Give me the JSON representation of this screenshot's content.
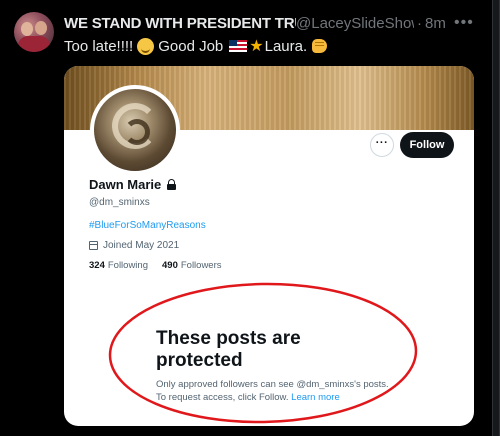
{
  "tweet": {
    "author_name": "WE STAND WITH PRESIDENT TRUMP",
    "handle": "@LaceySlideShow",
    "separator": "·",
    "time": "8m",
    "more_icon": "more-horizontal-icon",
    "text_part1": "Too late!!!!",
    "text_part2": "Good Job",
    "text_part3": "Laura.",
    "emojis": [
      "smiling-face-icon",
      "us-flag-icon",
      "star-icon",
      "oncoming-fist-icon"
    ]
  },
  "card": {
    "profile_name": "Dawn Marie",
    "profile_handle": "@dm_sminxs",
    "bio": "#BlueForSoManyReasons",
    "joined": "Joined May 2021",
    "following_count": "324",
    "following_label": "Following",
    "followers_count": "490",
    "followers_label": "Followers",
    "more_button": "···",
    "follow_button": "Follow",
    "protected_title": "These posts are protected",
    "protected_body": "Only approved followers can see @dm_sminxs's posts. To request access, click Follow.",
    "learn_more": "Learn more"
  },
  "colors": {
    "background": "#000000",
    "text_primary": "#e7e9ea",
    "text_secondary": "#71767b",
    "link": "#1d9bf0",
    "annotation": "#e0181b"
  }
}
